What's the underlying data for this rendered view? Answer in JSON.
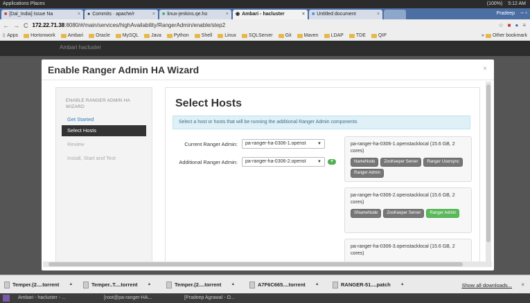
{
  "system_bar": {
    "left": "Applications  Places",
    "battery": "(100%)",
    "time": "5:12 AM"
  },
  "tabs": [
    {
      "label": "[Dal_India] Issue Na",
      "icon": "bug-icon"
    },
    {
      "label": "Commits · apache/r",
      "icon": "github-icon"
    },
    {
      "label": "linux-jenkins.qe.ho",
      "icon": "jenkins-icon"
    },
    {
      "label": "Ambari - hacluster",
      "icon": "ambari-icon",
      "active": true
    },
    {
      "label": "Untitled document",
      "icon": "doc-icon"
    }
  ],
  "tab_user": "Pradeep",
  "address": {
    "host": "172.22.71.38",
    "path": ":8080/#/main/services/highAvailability/RangerAdmin/enable/step2"
  },
  "bookmarks": [
    "Apps",
    "Hortonwork",
    "Ambari",
    "Oracle",
    "MySQL",
    "Java",
    "Python",
    "Shell",
    "Linux",
    "SQLServer",
    "Git",
    "Maven",
    "LDAP",
    "TDE",
    "QIP"
  ],
  "bookmarks_other": "Other bookmark",
  "app_brand": "Ambari    hacluster",
  "modal": {
    "title": "Enable Ranger Admin HA Wizard",
    "close": "×",
    "sidebar": {
      "heading": "ENABLE RANGER ADMIN HA WIZARD",
      "steps": [
        {
          "label": "Get Started",
          "state": "done"
        },
        {
          "label": "Select Hosts",
          "state": "active"
        },
        {
          "label": "Review",
          "state": "pending"
        },
        {
          "label": "Install, Start and Test",
          "state": "pending"
        }
      ]
    },
    "content": {
      "title": "Select Hosts",
      "alert": "Select a host or hosts that will be running the additional Ranger Admin components",
      "current_label": "Current Ranger Admin:",
      "current_value": "pa-ranger-ha-0306-1.openst",
      "additional_label": "Additional Ranger Admin:",
      "additional_value": "pa-ranger-ha-0306-2.openst",
      "add_label": "+",
      "hosts": [
        {
          "name": "pa-ranger-ha-0306-1.openstacklocal (15.6 GB, 2 cores)",
          "components": [
            {
              "label": "NameNode",
              "green": false
            },
            {
              "label": "ZooKeeper Server",
              "green": false
            },
            {
              "label": "Ranger Usersync",
              "green": false
            },
            {
              "label": "Ranger Admin",
              "green": false
            }
          ]
        },
        {
          "name": "pa-ranger-ha-0306-2.openstacklocal (15.6 GB, 2 cores)",
          "components": [
            {
              "label": "SNameNode",
              "green": false
            },
            {
              "label": "ZooKeeper Server",
              "green": false
            },
            {
              "label": "Ranger Admin",
              "green": true
            }
          ]
        },
        {
          "name": "pa-ranger-ha-0306-3.openstacklocal (15.6 GB, 2 cores)",
          "components": []
        }
      ]
    }
  },
  "downloads": {
    "items": [
      "Temper.(2....torrent",
      "Temper..T....torrent",
      "Temper.(2....torrent",
      "A7F6C665....torrent",
      "RANGER-51....patch"
    ],
    "show_all": "Show all downloads...",
    "close": "×"
  },
  "taskbar": [
    "Ambari - hacluster - ...",
    "[root@pa-ranger-HA...",
    "[Pradeep Agrawal - O..."
  ]
}
